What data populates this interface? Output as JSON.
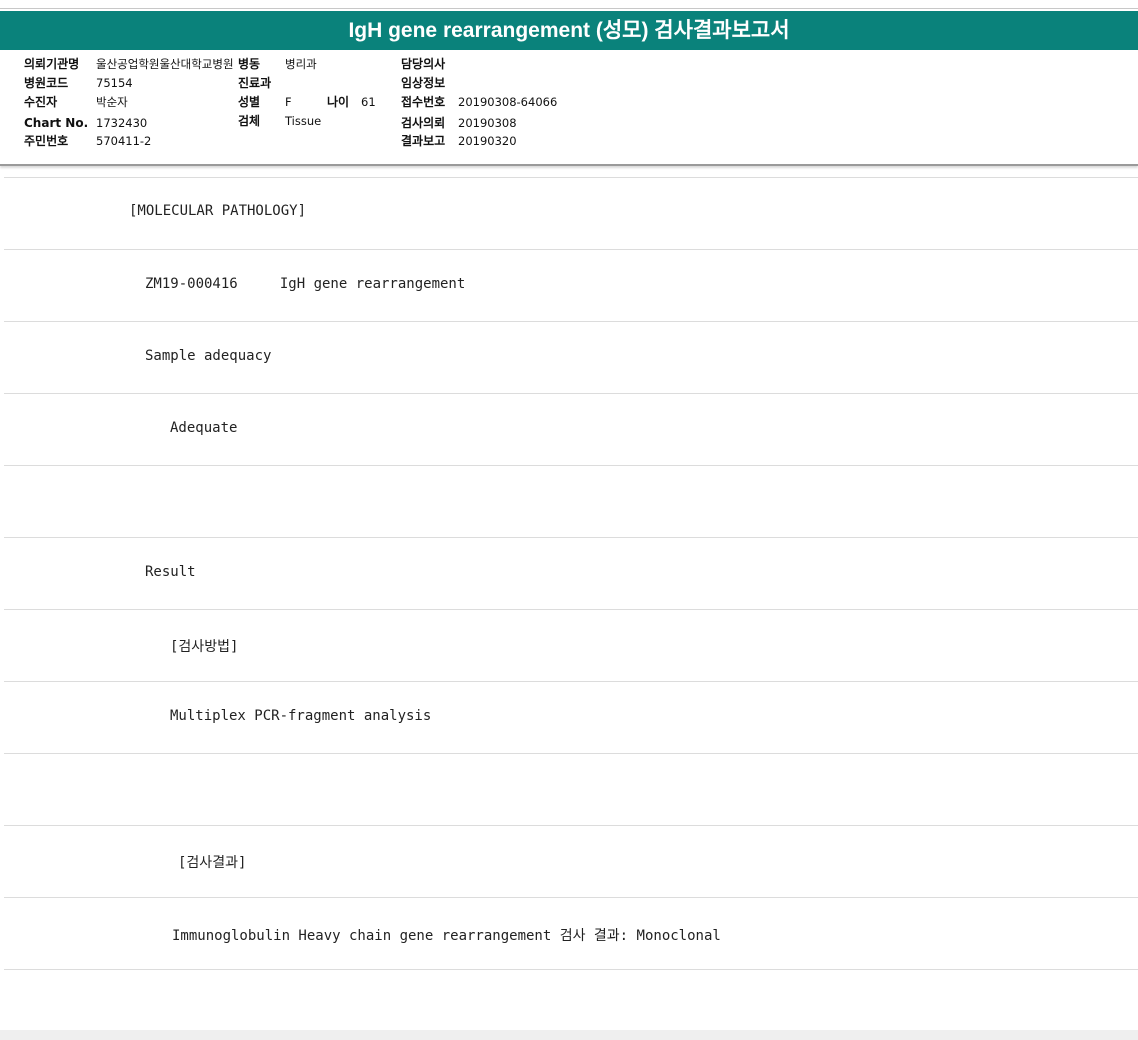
{
  "report": {
    "title": "IgH gene rearrangement (성모) 검사결과보고서"
  },
  "header": {
    "institution_label": "의뢰기관명",
    "institution_value": "울산공업학원울산대학교병원",
    "ward_label": "병동",
    "ward_value": "병리과",
    "doctor_label": "담당의사",
    "doctor_value": "",
    "hospital_code_label": "병원코드",
    "hospital_code_value": "75154",
    "department_label": "진료과",
    "department_value": "",
    "clinical_info_label": "임상정보",
    "clinical_info_value": "",
    "patient_label": "수진자",
    "patient_value": "박순자",
    "sex_label": "성별",
    "sex_value": "F",
    "age_label": "나이",
    "age_value": "61",
    "receipt_no_label": "접수번호",
    "receipt_no_value": "20190308-64066",
    "chart_label": "Chart No.",
    "chart_value": "1732430",
    "specimen_label": "검체",
    "specimen_value": "Tissue",
    "request_label": "검사의뢰",
    "request_value": "20190308",
    "id_label": "주민번호",
    "id_value": "570411-2",
    "report_date_label": "결과보고",
    "report_date_value": "20190320"
  },
  "lines": [
    {
      "text": "[MOLECULAR PATHOLOGY]"
    },
    {
      "text": "ZM19-000416     IgH gene rearrangement"
    },
    {
      "text": "Sample adequacy"
    },
    {
      "text": "Adequate"
    },
    {
      "text": ""
    },
    {
      "text": "Result"
    },
    {
      "text": "[검사방법]"
    },
    {
      "text": "Multiplex PCR-fragment analysis"
    },
    {
      "text": ""
    },
    {
      "text": "[검사결과]"
    },
    {
      "text": "Immunoglobulin Heavy chain gene rearrangement 검사 결과: Monoclonal"
    }
  ]
}
